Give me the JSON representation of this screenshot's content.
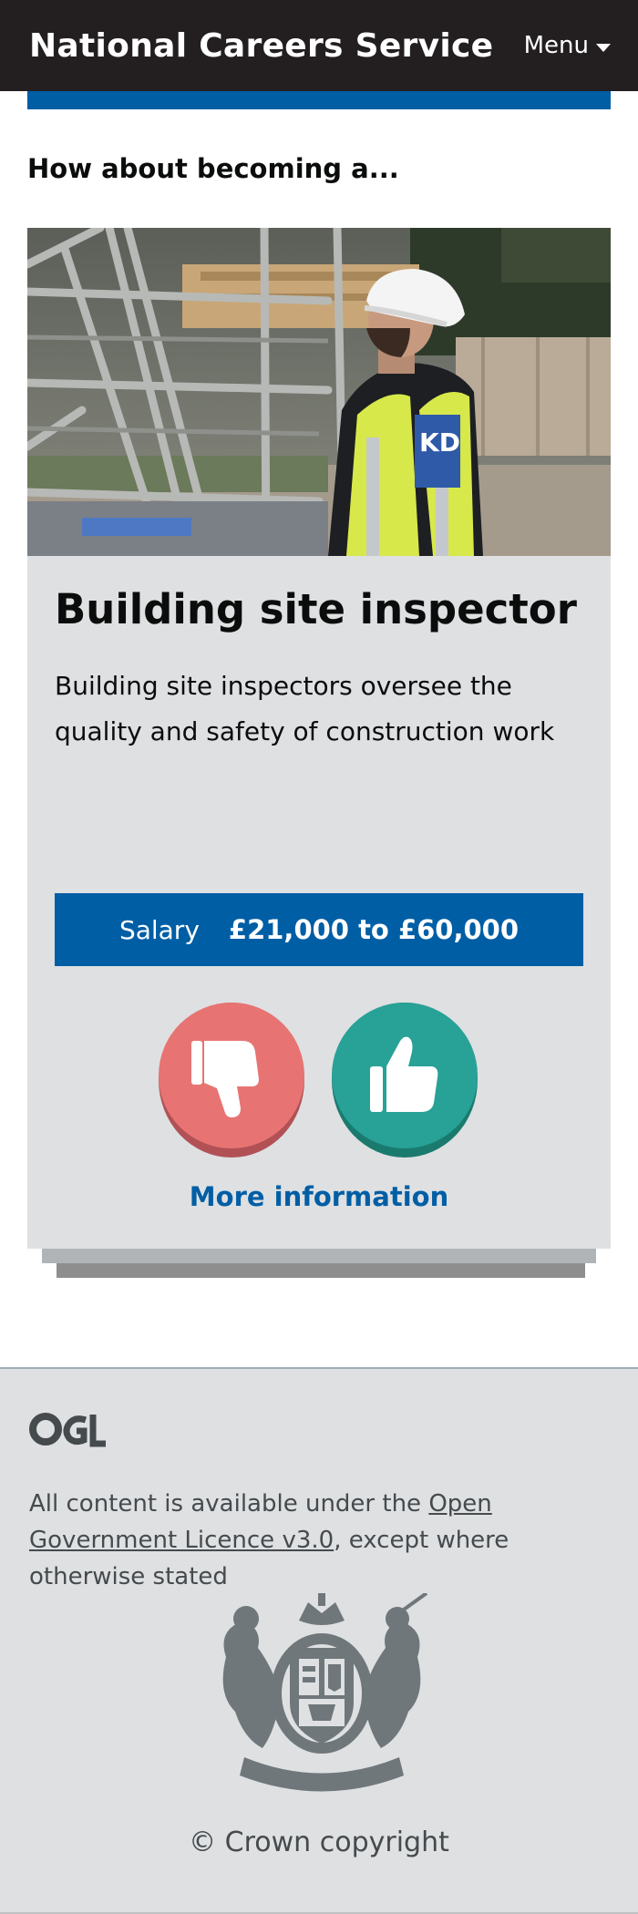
{
  "header": {
    "brand": "National Careers Service",
    "menu_label": "Menu"
  },
  "section": {
    "prompt": "How about becoming a..."
  },
  "card": {
    "title": "Building site inspector",
    "description": "Building site inspectors oversee the quality and safety of construction work",
    "salary_label": "Salary",
    "salary_value": "£21,000 to £60,000",
    "more_info": "More information",
    "dislike_icon": "thumbs-down-icon",
    "like_icon": "thumbs-up-icon",
    "vest_lettering": "KD"
  },
  "footer": {
    "logo_text": "OGL",
    "licence_prefix": "All content is available under the ",
    "licence_link": "Open Government Licence v3.0",
    "licence_suffix": ", except where otherwise stated",
    "copyright": "© Crown copyright"
  },
  "colors": {
    "header_bg": "#231f20",
    "brand_blue": "#005ea5",
    "dislike": "#e77473",
    "like": "#28a197",
    "card_bg": "#dee0e2"
  }
}
